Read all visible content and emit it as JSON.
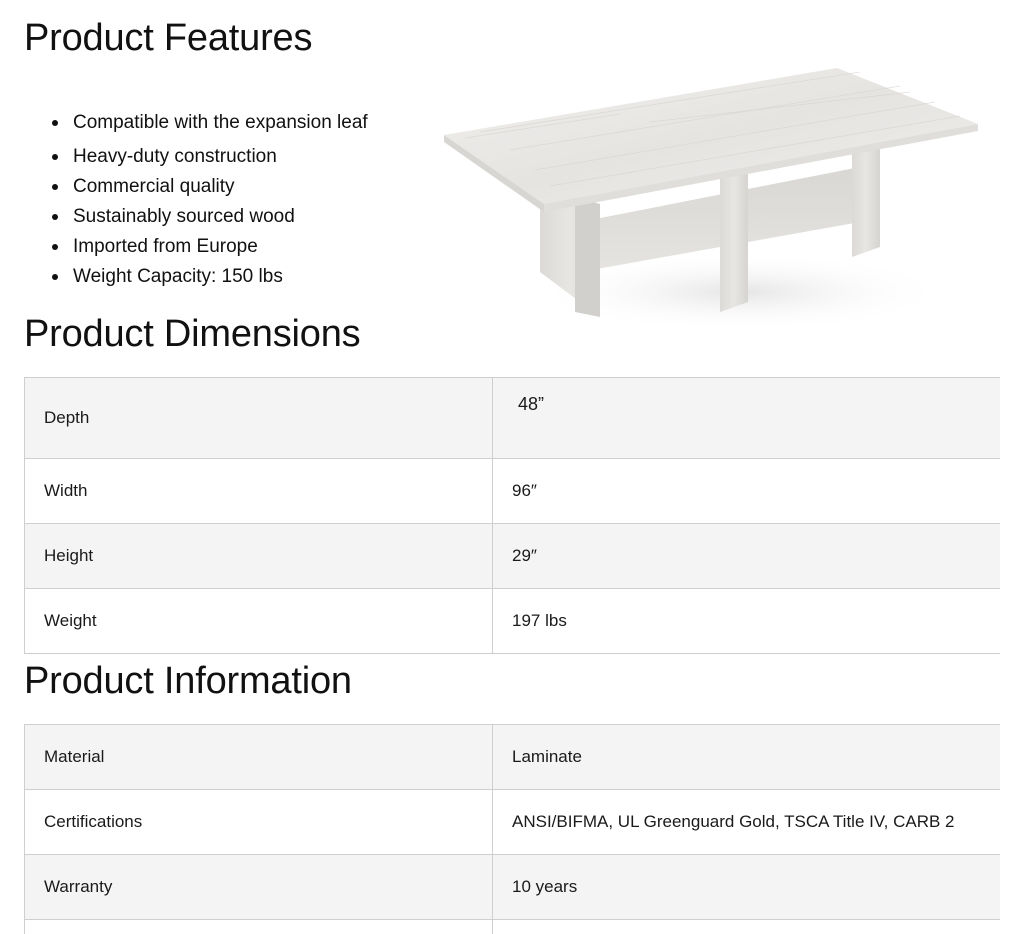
{
  "features": {
    "title": "Product Features",
    "items": [
      "Compatible with the expansion leaf",
      "Heavy-duty construction",
      "Commercial quality",
      "Sustainably sourced wood",
      "Imported from Europe",
      "Weight Capacity: 150 lbs"
    ]
  },
  "dimensions": {
    "title": "Product Dimensions",
    "rows": [
      {
        "label": "Depth",
        "value": "48”"
      },
      {
        "label": "Width",
        "value": "96″"
      },
      {
        "label": "Height",
        "value": "29″"
      },
      {
        "label": "Weight",
        "value": "197 lbs"
      }
    ]
  },
  "information": {
    "title": "Product Information",
    "rows": [
      {
        "label": "Material",
        "value": "Laminate"
      },
      {
        "label": "Certifications",
        "value": "ANSI/BIFMA, UL Greenguard Gold, TSCA Title IV, CARB 2"
      },
      {
        "label": "Warranty",
        "value": "10 years"
      }
    ]
  },
  "colors": {
    "table_border": "#cfcfcf",
    "row_shade": "#f4f4f4",
    "text": "#111111",
    "laminate": "#e9e7e4"
  }
}
